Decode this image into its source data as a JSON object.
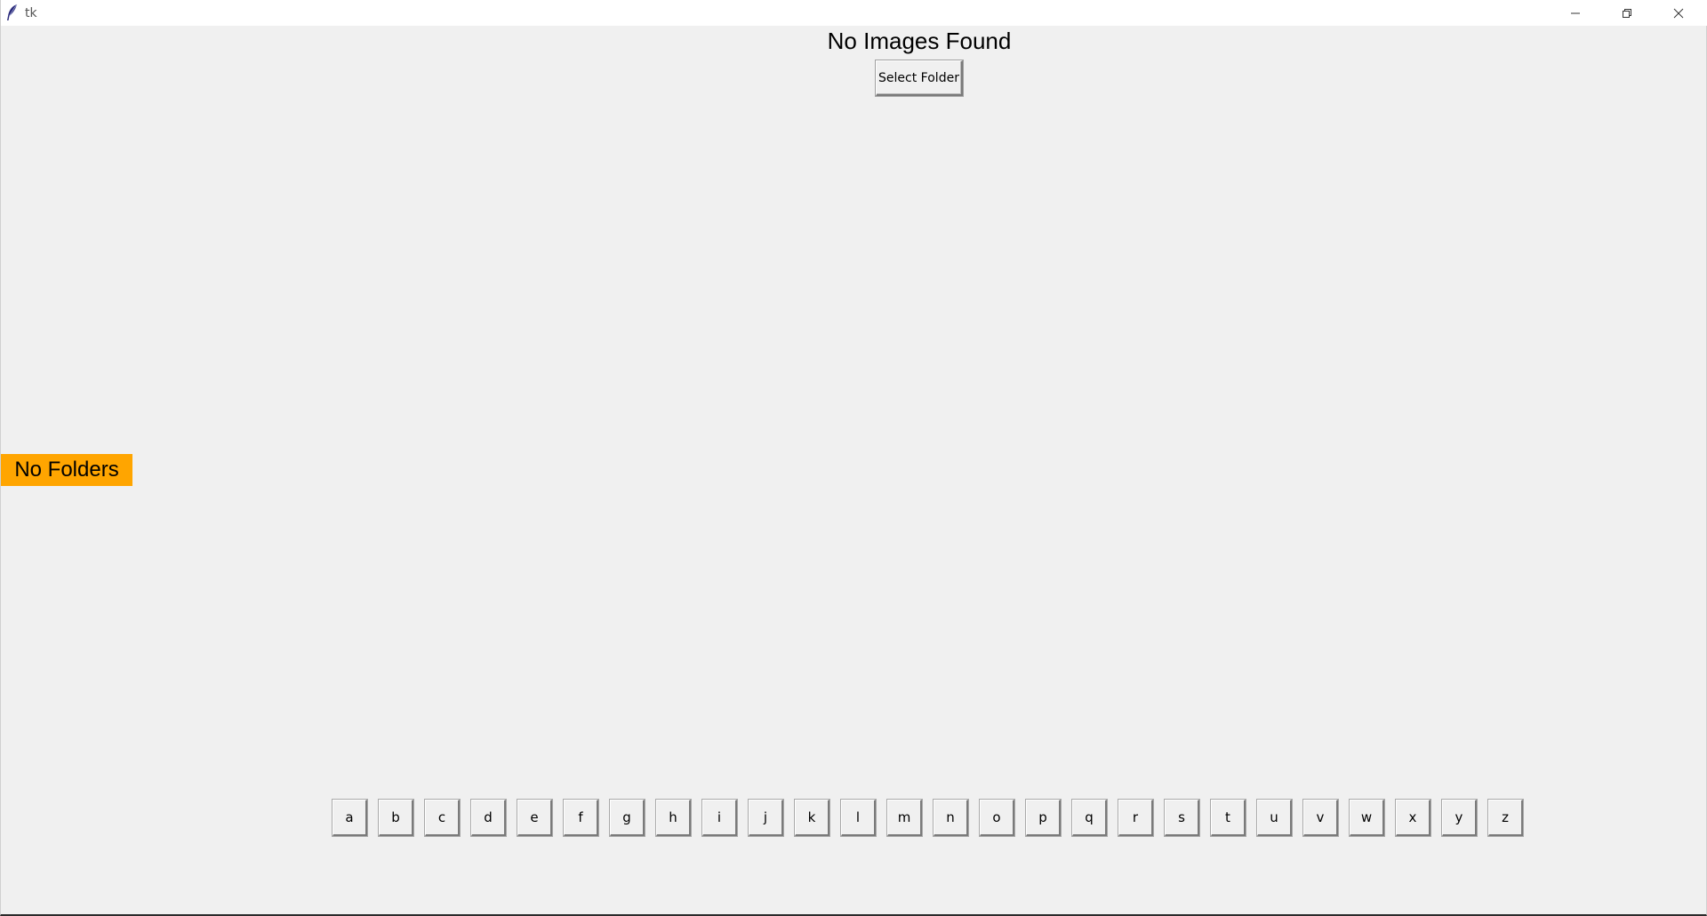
{
  "window": {
    "title": "tk"
  },
  "main": {
    "heading": "No Images Found",
    "select_folder_label": "Select Folder",
    "no_folders_label": "No Folders",
    "no_folders_color": "#ffa500"
  },
  "letters": [
    "a",
    "b",
    "c",
    "d",
    "e",
    "f",
    "g",
    "h",
    "i",
    "j",
    "k",
    "l",
    "m",
    "n",
    "o",
    "p",
    "q",
    "r",
    "s",
    "t",
    "u",
    "v",
    "w",
    "x",
    "y",
    "z"
  ]
}
